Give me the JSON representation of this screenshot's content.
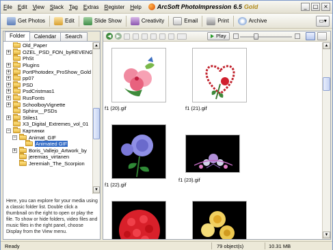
{
  "menu": [
    {
      "label": "File",
      "u": "F",
      "rest": "ile"
    },
    {
      "label": "Edit",
      "u": "E",
      "rest": "dit"
    },
    {
      "label": "View",
      "u": "V",
      "rest": "iew"
    },
    {
      "label": "Stack",
      "u": "S",
      "rest": "tack"
    },
    {
      "label": "Tag",
      "u": "T",
      "rest": "ag"
    },
    {
      "label": "Extras",
      "u": "E",
      "rest": "xtras"
    },
    {
      "label": "Register",
      "u": "R",
      "rest": "egister"
    },
    {
      "label": "Help",
      "u": "H",
      "rest": "elp"
    }
  ],
  "app": {
    "title": "ArcSoft PhotoImpression",
    "version": "6.5",
    "edition": "Gold"
  },
  "window_controls": {
    "minimize": "_",
    "maximize": "□",
    "close": "×"
  },
  "toolbar": {
    "get_photos": "Get Photos",
    "edit": "Edit",
    "slide_show": "Slide Show",
    "creativity": "Creativity",
    "email": "Email",
    "print": "Print",
    "archive": "Archive"
  },
  "left_tabs": [
    "Folder",
    "Calendar",
    "Search"
  ],
  "tree": [
    {
      "label": "Old_Paper",
      "indent": 1,
      "exp": ""
    },
    {
      "label": "OZEL_PSD_FON_byREVENGE",
      "indent": 1,
      "exp": "+"
    },
    {
      "label": "PhSt",
      "indent": 1,
      "exp": ""
    },
    {
      "label": "Plugins",
      "indent": 1,
      "exp": "+"
    },
    {
      "label": "PortPhotodex_ProShow_Gold",
      "indent": 1,
      "exp": "+"
    },
    {
      "label": "pp07",
      "indent": 1,
      "exp": "+"
    },
    {
      "label": "PSD",
      "indent": 1,
      "exp": "+"
    },
    {
      "label": "PsdCristmas1",
      "indent": 1,
      "exp": "+"
    },
    {
      "label": "RusFonts",
      "indent": 1,
      "exp": "+"
    },
    {
      "label": "SchoolboyVignette",
      "indent": 1,
      "exp": "+"
    },
    {
      "label": "Sphinx__PSDs",
      "indent": 1,
      "exp": ""
    },
    {
      "label": "Stiles1",
      "indent": 1,
      "exp": "+"
    },
    {
      "label": "X3_Digital_Extremes_vol_01",
      "indent": 1,
      "exp": ""
    },
    {
      "label": "Картинки",
      "indent": 1,
      "exp": "−"
    },
    {
      "label": "Animat_GIF",
      "indent": 2,
      "exp": "−"
    },
    {
      "label": "Animated GIF",
      "indent": 3,
      "exp": "",
      "selected": true
    },
    {
      "label": "Boris_Vallejo_Artwork_by",
      "indent": 2,
      "exp": "+"
    },
    {
      "label": "jeremias_virtanen",
      "indent": 2,
      "exp": ""
    },
    {
      "label": "Jeremiah_The_Scorpion",
      "indent": 2,
      "exp": ""
    }
  ],
  "info_text": "Here, you can explore for your media using a classic folder list. Double click a thumbnail on the right to open or play the file. To show or hide folders, video files and music files in the right panel, choose Display from the View menu.",
  "right_toolbar": {
    "play": "Play"
  },
  "thumbnails": [
    {
      "file": "f1 (20).gif",
      "bg": "#ffffff",
      "kind": "hibiscus"
    },
    {
      "file": "f1 (21).gif",
      "bg": "#ffffff",
      "kind": "heart"
    },
    {
      "file": "f1 (22).gif",
      "bg": "#000000",
      "kind": "rose"
    },
    {
      "file": "f1 (23).gif",
      "bg": "#000000",
      "kind": "orchid"
    },
    {
      "file": "",
      "bg": "#000000",
      "kind": "redbouquet"
    },
    {
      "file": "",
      "bg": "#000000",
      "kind": "yellowroses"
    }
  ],
  "status": {
    "left": "Ready",
    "count": "79 object(s)",
    "size": "10.31 MB"
  }
}
